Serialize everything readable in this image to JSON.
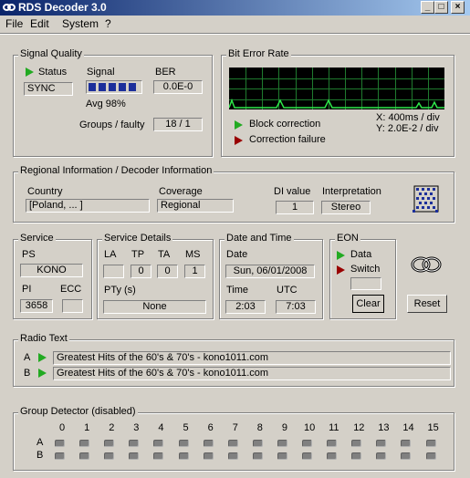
{
  "window": {
    "title": "RDS Decoder 3.0",
    "btn_min": "_",
    "btn_max": "□",
    "btn_close": "×"
  },
  "menu": {
    "file": "File",
    "edit": "Edit",
    "system": "System",
    "help": "?"
  },
  "signal_quality": {
    "group_label": "Signal Quality",
    "status_label": "Status",
    "status_value": "SYNC",
    "signal_label": "Signal",
    "signal_avg": "Avg  98%",
    "signal_level": 0.98,
    "ber_label": "BER",
    "ber_value": "0.0E-0",
    "groups_label": "Groups / faulty",
    "groups_value": "18 / 1"
  },
  "bit_error_rate": {
    "group_label": "Bit Error Rate",
    "block_correction": "Block correction",
    "correction_failure": "Correction failure",
    "x_scale": "X: 400ms / div",
    "y_scale": "Y: 2.0E-2 / div",
    "graph_color": "#2ee84a",
    "grid_color": "#1f7a2e"
  },
  "regional": {
    "group_label": "Regional Information / Decoder Information",
    "country_label": "Country",
    "country_value": "[Poland, ... ]",
    "coverage_label": "Coverage",
    "coverage_value": "Regional",
    "di_label": "DI value",
    "di_value": "1",
    "interp_label": "Interpretation",
    "interp_value": "Stereo"
  },
  "service": {
    "group_label": "Service",
    "ps_label": "PS",
    "ps_value": "KONO",
    "pi_label": "PI",
    "pi_value": "3658",
    "ecc_label": "ECC",
    "ecc_value": ""
  },
  "service_details": {
    "group_label": "Service Details",
    "la_label": "LA",
    "tp_label": "TP",
    "ta_label": "TA",
    "ms_label": "MS",
    "la_value": "",
    "tp_value": "0",
    "ta_value": "0",
    "ms_value": "1",
    "pty_label": "PTy (s)",
    "pty_value": "None"
  },
  "date_time": {
    "group_label": "Date and Time",
    "date_label": "Date",
    "date_value": "Sun, 06/01/2008",
    "time_label": "Time",
    "time_value": "2:03",
    "utc_label": "UTC",
    "utc_value": "7:03"
  },
  "eon": {
    "group_label": "EON",
    "data_label": "Data",
    "switch_label": "Switch",
    "clear_label": "Clear"
  },
  "reset_label": "Reset",
  "radio_text": {
    "group_label": "Radio Text",
    "a_label": "A",
    "a_value": "Greatest Hits of the 60's & 70's - kono1011.com",
    "b_label": "B",
    "b_value": "Greatest Hits of the 60's & 70's - kono1011.com"
  },
  "group_detector": {
    "group_label": "Group Detector (disabled)",
    "columns": [
      "0",
      "1",
      "2",
      "3",
      "4",
      "5",
      "6",
      "7",
      "8",
      "9",
      "10",
      "11",
      "12",
      "13",
      "14",
      "15"
    ],
    "row_a": "A",
    "row_b": "B"
  }
}
